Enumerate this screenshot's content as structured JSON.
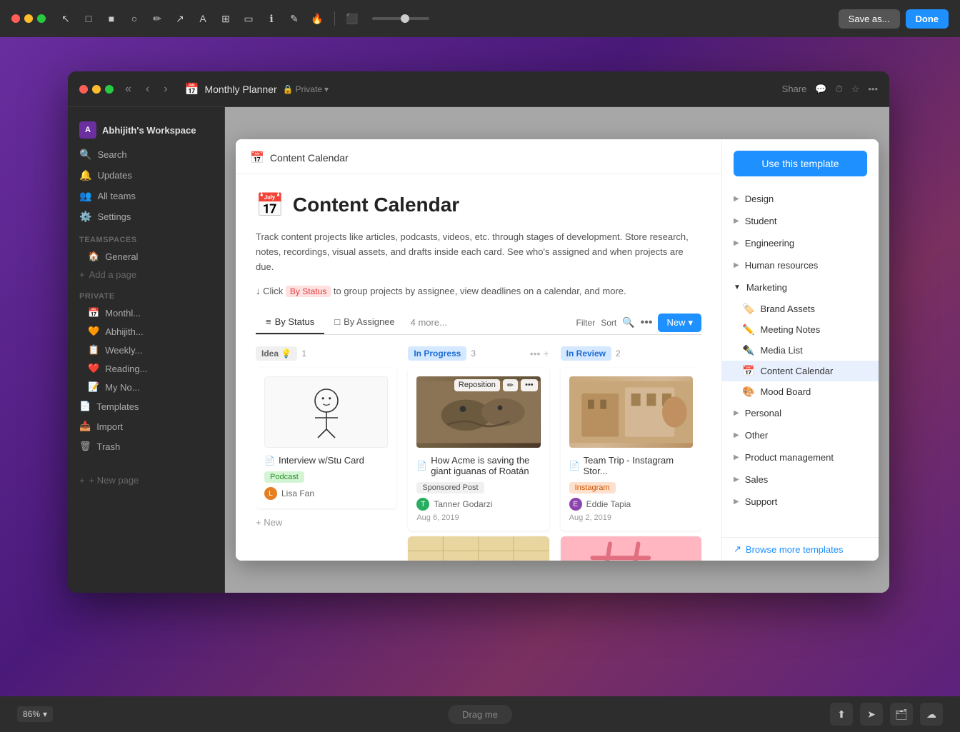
{
  "topToolbar": {
    "saveAs": "Save as...",
    "done": "Done",
    "zoom": "86%"
  },
  "window": {
    "title": "Monthly Planner",
    "privacy": "Private"
  },
  "sidebar": {
    "workspace": "Abhijith's Workspace",
    "items": [
      {
        "label": "Search",
        "icon": "🔍"
      },
      {
        "label": "Updates",
        "icon": "🔔"
      },
      {
        "label": "All teams",
        "icon": "👥"
      },
      {
        "label": "Settings",
        "icon": "⚙️"
      }
    ],
    "teamspacesLabel": "Teamspaces",
    "teamspaces": [
      {
        "label": "General",
        "icon": "🏠"
      }
    ],
    "addPageLabel": "Add a page",
    "privateLabel": "Private",
    "privateItems": [
      {
        "label": "Monthl...",
        "icon": "📅"
      },
      {
        "label": "Abhijith...",
        "icon": "🧡"
      },
      {
        "label": "Weekly...",
        "icon": "📋"
      },
      {
        "label": "Reading...",
        "icon": "❤️"
      },
      {
        "label": "My No...",
        "icon": "📝"
      }
    ],
    "templateLabel": "Templates",
    "importLabel": "Import",
    "trashLabel": "Trash",
    "newPageLabel": "+ New page"
  },
  "modal": {
    "headerIcon": "📅",
    "headerTitle": "Content Calendar",
    "mainIcon": "📅",
    "mainTitle": "Content Calendar",
    "description": "Track content projects like articles, podcasts, videos, etc. through stages of development.\nStore research, notes, recordings, visual assets, and drafts inside each card.\nSee who's assigned and when projects are due.",
    "hint": "↓ Click",
    "hintHighlight": "By Status",
    "hintRest": "to group projects by assignee, view deadlines on a calendar, and more.",
    "useTemplateBtn": "Use this template",
    "views": [
      {
        "label": "By Status",
        "icon": "≡",
        "active": true
      },
      {
        "label": "By Assignee",
        "icon": "□"
      },
      {
        "label": "4 more...",
        "icon": ""
      }
    ],
    "viewActions": {
      "filter": "Filter",
      "sort": "Sort",
      "newBtn": "New"
    },
    "columns": [
      {
        "name": "Idea",
        "icon": "💡",
        "count": "1",
        "style": "idea",
        "cards": [
          {
            "hasImage": false,
            "imageType": "drawing",
            "docIcon": "📄",
            "title": "Interview w/Stu Card",
            "tag": "Podcast",
            "tagStyle": "tag-podcast",
            "author": "Lisa Fan",
            "avatarColor": "#e67e22",
            "date": ""
          }
        ]
      },
      {
        "name": "In Progress",
        "count": "3",
        "style": "in-progress",
        "cards": [
          {
            "hasImage": true,
            "imageType": "iguanas",
            "reposition": true,
            "docIcon": "📄",
            "title": "How Acme is saving the giant iguanas of Roatán",
            "tag": "Sponsored Post",
            "tagStyle": "tag-sponsored",
            "author": "Tanner Godarzi",
            "avatarColor": "#27ae60",
            "date": "Aug 6, 2019"
          },
          {
            "hasImage": true,
            "imageType": "map",
            "docIcon": "",
            "title": "",
            "tag": "",
            "tagStyle": "",
            "author": "",
            "date": ""
          }
        ]
      },
      {
        "name": "In Review",
        "count": "2",
        "style": "in-review",
        "cards": [
          {
            "hasImage": true,
            "imageType": "building",
            "docIcon": "📄",
            "title": "Team Trip - Instagram Stor...",
            "tag": "Instagram",
            "tagStyle": "tag-instagram",
            "author": "Eddie Tapia",
            "avatarColor": "#8e44ad",
            "date": "Aug 2, 2019"
          },
          {
            "hasImage": true,
            "imageType": "hashtag",
            "docIcon": "",
            "title": "",
            "tag": "",
            "tagStyle": "",
            "author": "",
            "date": ""
          }
        ]
      }
    ],
    "addNew": "+ New",
    "categories": {
      "design": "Design",
      "student": "Student",
      "engineering": "Engineering",
      "humanResources": "Human resources",
      "marketing": "Marketing",
      "subItems": [
        {
          "icon": "🏷️",
          "label": "Brand Assets"
        },
        {
          "icon": "✏️",
          "label": "Meeting Notes"
        },
        {
          "icon": "✒️",
          "label": "Media List"
        },
        {
          "icon": "📅",
          "label": "Content Calendar",
          "active": true
        },
        {
          "icon": "🎨",
          "label": "Mood Board"
        }
      ],
      "personal": "Personal",
      "other": "Other",
      "productManagement": "Product management",
      "sales": "Sales",
      "support": "Support",
      "browseMore": "Browse more templates"
    }
  },
  "bottomBar": {
    "zoom": "86%",
    "dragMe": "Drag me"
  }
}
